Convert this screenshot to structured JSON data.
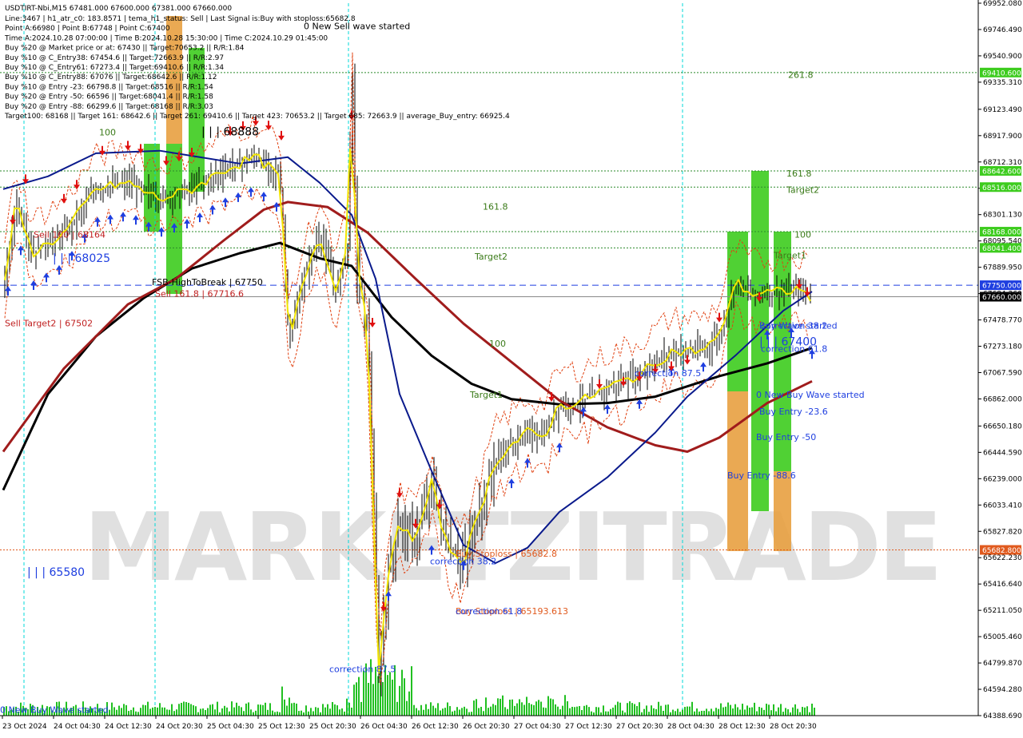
{
  "header": {
    "symbol_line": "USDTIRT-Nbi,M15 67481.000 67600.000 67381.000 67660.000",
    "info_lines": [
      "Line:3467 | h1_atr_c0: 183.8571 | tema_h1_status: Sell | Last Signal is:Buy with stoploss:65682.8",
      "Point A:66980 | Point B:67748 | Point C:67400",
      "Time A:2024.10.28 07:00:00 | Time B:2024.10.28 15:30:00 | Time C:2024.10.29 01:45:00",
      "Buy %20 @ Market price or at: 67430 || Target:70653.2 || R/R:1.84",
      "Buy %10 @ C_Entry38: 67454.6 || Target:72663.9 || R/R:2.97",
      "Buy %10 @ C_Entry61: 67273.4 || Target:69410.6 || R/R:1.34",
      "Buy %10 @ C_Entry88: 67076 || Target:68642.6 || R/R:1.12",
      "Buy %10 @ Entry -23: 66798.8 || Target:68516 || R/R:1.54",
      "Buy %20 @ Entry -50: 66596 || Target:68041.4 || R/R:1.58",
      "Buy %20 @ Entry -88: 66299.6 || Target:68168 || R/R:3.03",
      "Target100: 68168 || Target 161: 68642.6 || Target 261: 69410.6 || Target 423: 70653.2 || Target 685: 72663.9 || average_Buy_entry: 66925.4"
    ]
  },
  "colors": {
    "buy": "#1f3fe0",
    "sell": "#e01010",
    "green_zone": "#3dcc1e",
    "orange_zone": "#e8a040",
    "ma_red": "#a01c1c",
    "ma_black": "#000000",
    "ma_navy": "#0a1a8c",
    "tema_yellow": "#f2e500",
    "target_text": "#3a7a18",
    "grid_cyan": "#00d8d8",
    "watermark": "#c7c7c7"
  },
  "chart_data": {
    "type": "candlestick",
    "symbol": "USDTIRT-Nbi",
    "timeframe": "M15",
    "ylim": [
      64388.69,
      69952.08
    ],
    "y_ticks": [
      69952.08,
      69746.49,
      69540.9,
      69335.31,
      69123.49,
      68917.9,
      68712.31,
      68506.72,
      68301.13,
      68095.54,
      67889.95,
      67684.36,
      67478.77,
      67273.18,
      67067.59,
      66862.0,
      66650.18,
      66444.59,
      66239.0,
      66033.41,
      65827.82,
      65622.23,
      65416.64,
      65211.05,
      65005.46,
      64799.87,
      64594.28,
      64388.69
    ],
    "x_tick_labels": [
      "23 Oct 2024",
      "24 Oct 04:30",
      "24 Oct 12:30",
      "24 Oct 20:30",
      "25 Oct 04:30",
      "25 Oct 12:30",
      "25 Oct 20:30",
      "26 Oct 04:30",
      "26 Oct 12:30",
      "26 Oct 20:30",
      "27 Oct 04:30",
      "27 Oct 12:30",
      "27 Oct 20:30",
      "28 Oct 04:30",
      "28 Oct 12:30",
      "28 Oct 20:30"
    ],
    "price_tags": [
      {
        "value": "69410.600",
        "price": 69410.6,
        "color": "#3dcc1e"
      },
      {
        "value": "68642.600",
        "price": 68642.6,
        "color": "#3dcc1e"
      },
      {
        "value": "68516.000",
        "price": 68516.0,
        "color": "#3dcc1e"
      },
      {
        "value": "68168.000",
        "price": 68168.0,
        "color": "#3dcc1e"
      },
      {
        "value": "68041.400",
        "price": 68041.4,
        "color": "#3dcc1e"
      },
      {
        "value": "67750.000",
        "price": 67750.0,
        "color": "#1f3fe0"
      },
      {
        "value": "67660.000",
        "price": 67660.0,
        "color": "#000000"
      },
      {
        "value": "65682.800",
        "price": 65682.8,
        "color": "#e05a1e"
      }
    ],
    "horizontal_lines": [
      {
        "price": 69410.6,
        "style": "dotted",
        "color": "#2a8a2a"
      },
      {
        "price": 68642.6,
        "style": "dotted",
        "color": "#2a8a2a"
      },
      {
        "price": 68516.0,
        "style": "dotted",
        "color": "#2a8a2a"
      },
      {
        "price": 68168.0,
        "style": "dotted",
        "color": "#2a8a2a"
      },
      {
        "price": 68041.4,
        "style": "dotted",
        "color": "#2a8a2a"
      },
      {
        "price": 67750.0,
        "style": "dashed",
        "color": "#1f3fe0"
      },
      {
        "price": 67660.0,
        "style": "solid",
        "color": "#888888"
      },
      {
        "price": 65682.8,
        "style": "dotted",
        "color": "#e05a1e"
      }
    ],
    "annotations": [
      {
        "text": "0 New Sell wave started",
        "price": 69750,
        "color": "#000000"
      },
      {
        "text": "261.8",
        "price": 69370,
        "color": "#3a7a18"
      },
      {
        "text": "161.8",
        "price": 68600,
        "color": "#3a7a18"
      },
      {
        "text": "Target2",
        "price": 68470,
        "color": "#3a7a18"
      },
      {
        "text": "161.8",
        "price": 68340,
        "color": "#3a7a18"
      },
      {
        "text": "100",
        "price": 68120,
        "color": "#3a7a18"
      },
      {
        "text": "Target2",
        "price": 67950,
        "color": "#3a7a18"
      },
      {
        "text": "Target1",
        "price": 67960,
        "color": "#3a7a18"
      },
      {
        "text": "100",
        "price": 67270,
        "color": "#3a7a18"
      },
      {
        "text": "Target1",
        "price": 66870,
        "color": "#3a7a18"
      },
      {
        "text": "100",
        "price": 68920,
        "color": "#3a7a18"
      },
      {
        "text": "| | | 68888",
        "price": 68920,
        "color": "#000000"
      },
      {
        "text": "Sell 100 | 68164",
        "price": 68120,
        "color": "#c02020"
      },
      {
        "text": "| | | 68025",
        "price": 67930,
        "color": "#1f3fe0"
      },
      {
        "text": "FSB-HighToBreak | 67750",
        "price": 67750,
        "color": "#000000"
      },
      {
        "text": "Sell 161.8 | 67716.6",
        "price": 67660,
        "color": "#c02020"
      },
      {
        "text": "Sell Target2 | 67502",
        "price": 67430,
        "color": "#c02020"
      },
      {
        "text": "Buy Wave started",
        "price": 67410,
        "color": "#1f3fe0"
      },
      {
        "text": "correction 38.2",
        "price": 67410,
        "color": "#1f3fe0"
      },
      {
        "text": "correction 61.8",
        "price": 67230,
        "color": "#1f3fe0"
      },
      {
        "text": "| | | 67400",
        "price": 67280,
        "color": "#1f3fe0"
      },
      {
        "text": "correction 87.5",
        "price": 67040,
        "color": "#1f3fe0"
      },
      {
        "text": "0 New Buy Wave started",
        "price": 66870,
        "color": "#1f3fe0"
      },
      {
        "text": "Buy Entry -23.6",
        "price": 66740,
        "color": "#1f3fe0"
      },
      {
        "text": "Buy Entry -50",
        "price": 66540,
        "color": "#1f3fe0"
      },
      {
        "text": "Buy Entry -88.6",
        "price": 66240,
        "color": "#1f3fe0"
      },
      {
        "text": "Buy Stoploss | 65682.8",
        "price": 65630,
        "color": "#e05a1e"
      },
      {
        "text": "correction 38.2",
        "price": 65570,
        "color": "#1f3fe0"
      },
      {
        "text": "| | | 65580",
        "price": 65480,
        "color": "#1f3fe0"
      },
      {
        "text": "Buy Stoploss | 65193.613",
        "price": 65180,
        "color": "#e05a1e"
      },
      {
        "text": "correction 61.8",
        "price": 65180,
        "color": "#1f3fe0"
      },
      {
        "text": "correction 87.5",
        "price": 64730,
        "color": "#1f3fe0"
      },
      {
        "text": "0 New Buy Wave started",
        "price": 64410,
        "color": "#1f3fe0"
      }
    ],
    "watermark": "MARKETZITRADE"
  }
}
